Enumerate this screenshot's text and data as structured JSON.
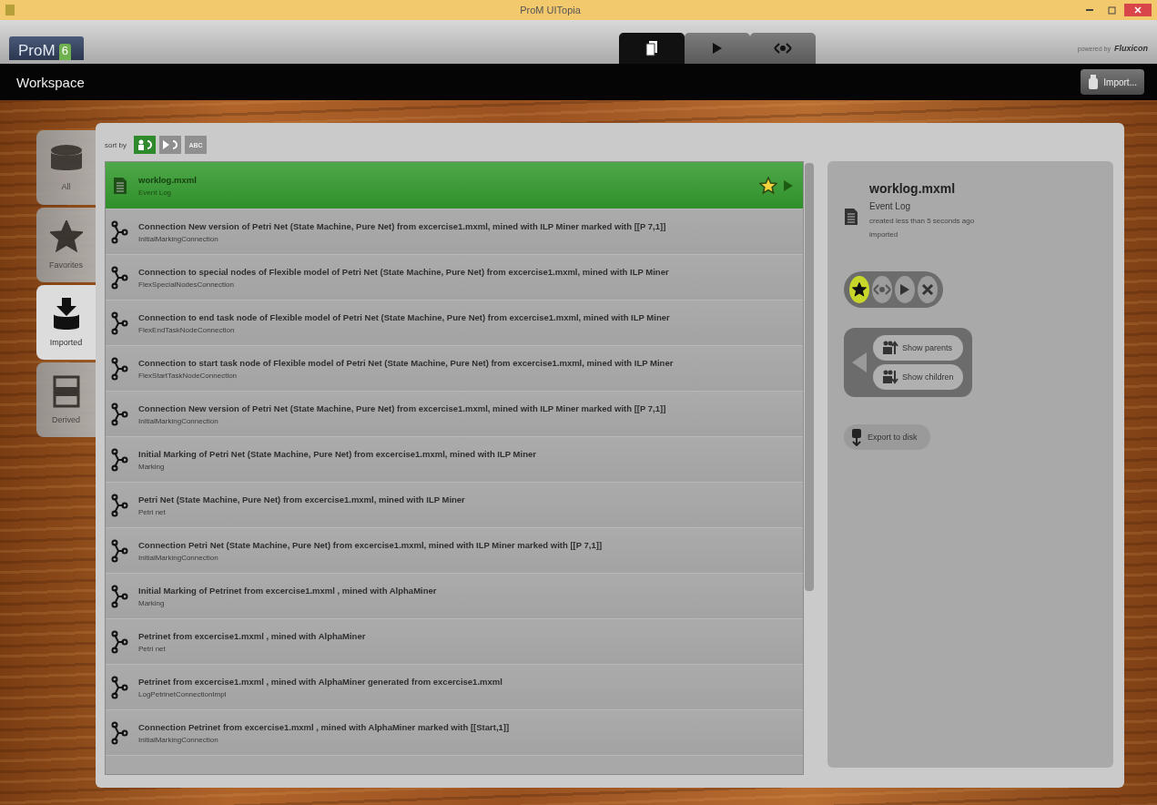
{
  "window": {
    "title": "ProM UITopia"
  },
  "toolbar": {
    "logo": "ProM",
    "logo_version": "6",
    "views": [
      {
        "kind": "workspace",
        "selected": true
      },
      {
        "kind": "actions",
        "selected": false
      },
      {
        "kind": "views",
        "selected": false
      }
    ],
    "powered_by": "powered by",
    "brand": "Fluxicon"
  },
  "header": {
    "title": "Workspace",
    "import_button": "Import..."
  },
  "sidebar": [
    {
      "kind": "all",
      "label": "All",
      "selected": false
    },
    {
      "kind": "favorites",
      "label": "Favorites",
      "selected": false
    },
    {
      "kind": "imported",
      "label": "Imported",
      "selected": true
    },
    {
      "kind": "derived",
      "label": "Derived",
      "selected": false
    }
  ],
  "sort": {
    "label": "sort by",
    "options": [
      {
        "kind": "imported",
        "selected": true
      },
      {
        "kind": "produced",
        "selected": false
      },
      {
        "kind": "name",
        "label": "ABC",
        "selected": false
      }
    ]
  },
  "items": [
    {
      "kind": "log",
      "title": "worklog.mxml",
      "type": "Event Log",
      "selected": true,
      "favorite": true
    },
    {
      "kind": "net",
      "title": "Connection New version of Petri Net (State Machine, Pure Net) from excercise1.mxml, mined with ILP Miner marked with [[P 7,1]]",
      "type": "InitialMarkingConnection",
      "selected": false
    },
    {
      "kind": "net",
      "title": "Connection to special nodes of Flexible model of Petri Net (State Machine, Pure Net) from excercise1.mxml, mined with ILP Miner",
      "type": "FlexSpecialNodesConnection",
      "selected": false
    },
    {
      "kind": "net",
      "title": "Connection to end task node of Flexible model of Petri Net (State Machine, Pure Net) from excercise1.mxml, mined with ILP Miner",
      "type": "FlexEndTaskNodeConnection",
      "selected": false
    },
    {
      "kind": "net",
      "title": "Connection to start task node of Flexible model of Petri Net (State Machine, Pure Net) from excercise1.mxml, mined with ILP Miner",
      "type": "FlexStartTaskNodeConnection",
      "selected": false
    },
    {
      "kind": "net",
      "title": "Connection New version of Petri Net (State Machine, Pure Net) from excercise1.mxml, mined with ILP Miner marked with [[P 7,1]]",
      "type": "InitialMarkingConnection",
      "selected": false
    },
    {
      "kind": "net",
      "title": "Initial Marking of Petri Net (State Machine, Pure Net) from excercise1.mxml, mined with ILP Miner",
      "type": "Marking",
      "selected": false
    },
    {
      "kind": "net",
      "title": "Petri Net (State Machine, Pure Net) from excercise1.mxml, mined with ILP Miner",
      "type": "Petri net",
      "selected": false
    },
    {
      "kind": "net",
      "title": "Connection Petri Net (State Machine, Pure Net) from excercise1.mxml, mined with ILP Miner marked with [[P 7,1]]",
      "type": "InitialMarkingConnection",
      "selected": false
    },
    {
      "kind": "net",
      "title": "Initial Marking of Petrinet from excercise1.mxml , mined with AlphaMiner",
      "type": "Marking",
      "selected": false
    },
    {
      "kind": "net",
      "title": "Petrinet from excercise1.mxml , mined with AlphaMiner",
      "type": "Petri net",
      "selected": false
    },
    {
      "kind": "net",
      "title": "Petrinet from excercise1.mxml , mined with AlphaMiner generated from excercise1.mxml",
      "type": "LogPetrinetConnectionImpl",
      "selected": false
    },
    {
      "kind": "net",
      "title": "Connection Petrinet from excercise1.mxml , mined with AlphaMiner marked with [[Start,1]]",
      "type": "InitialMarkingConnection",
      "selected": false
    }
  ],
  "detail": {
    "name": "worklog.mxml",
    "type": "Event Log",
    "created": "created less than 5 seconds ago",
    "source": "imported",
    "actions": [
      {
        "kind": "favorite",
        "on": true
      },
      {
        "kind": "view",
        "on": false
      },
      {
        "kind": "play",
        "on": false
      },
      {
        "kind": "remove",
        "on": false
      }
    ],
    "show_parents": "Show parents",
    "show_children": "Show children",
    "export": "Export to disk"
  }
}
